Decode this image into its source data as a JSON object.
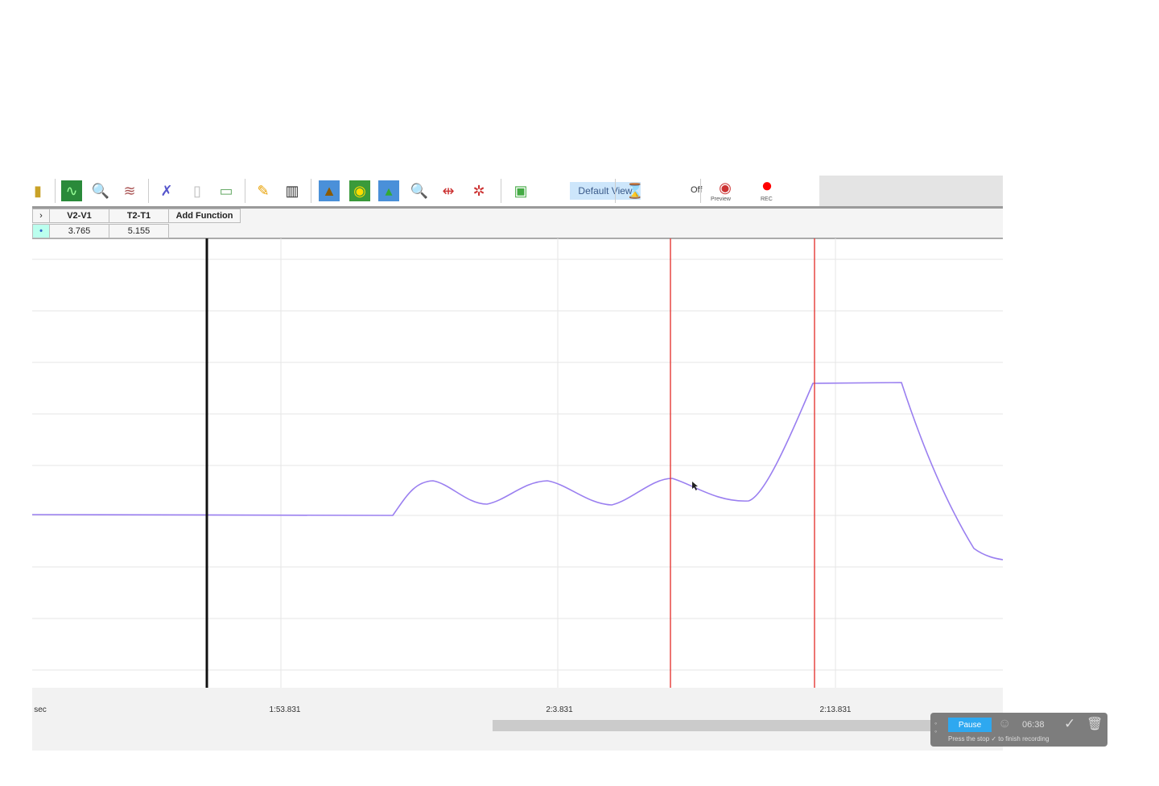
{
  "toolbar": {
    "default_view": "Default View",
    "off": "Off",
    "preview": "Preview",
    "rec": "REC",
    "rec_color": "#ff0000"
  },
  "measure": {
    "headers": [
      "V2-V1",
      "T2-T1",
      "Add Function"
    ],
    "values": [
      "3.765",
      "5.155"
    ]
  },
  "axis": {
    "unit": "sec",
    "ticks": [
      "1:53.831",
      "2:3.831",
      "2:13.831"
    ]
  },
  "recorder": {
    "pause": "Pause",
    "time": "06:38",
    "hint": "Press the stop ✓ to finish recording"
  },
  "colors": {
    "signal": "#9a7ff0",
    "cursor": "#e53935",
    "marker": "#111111"
  }
}
